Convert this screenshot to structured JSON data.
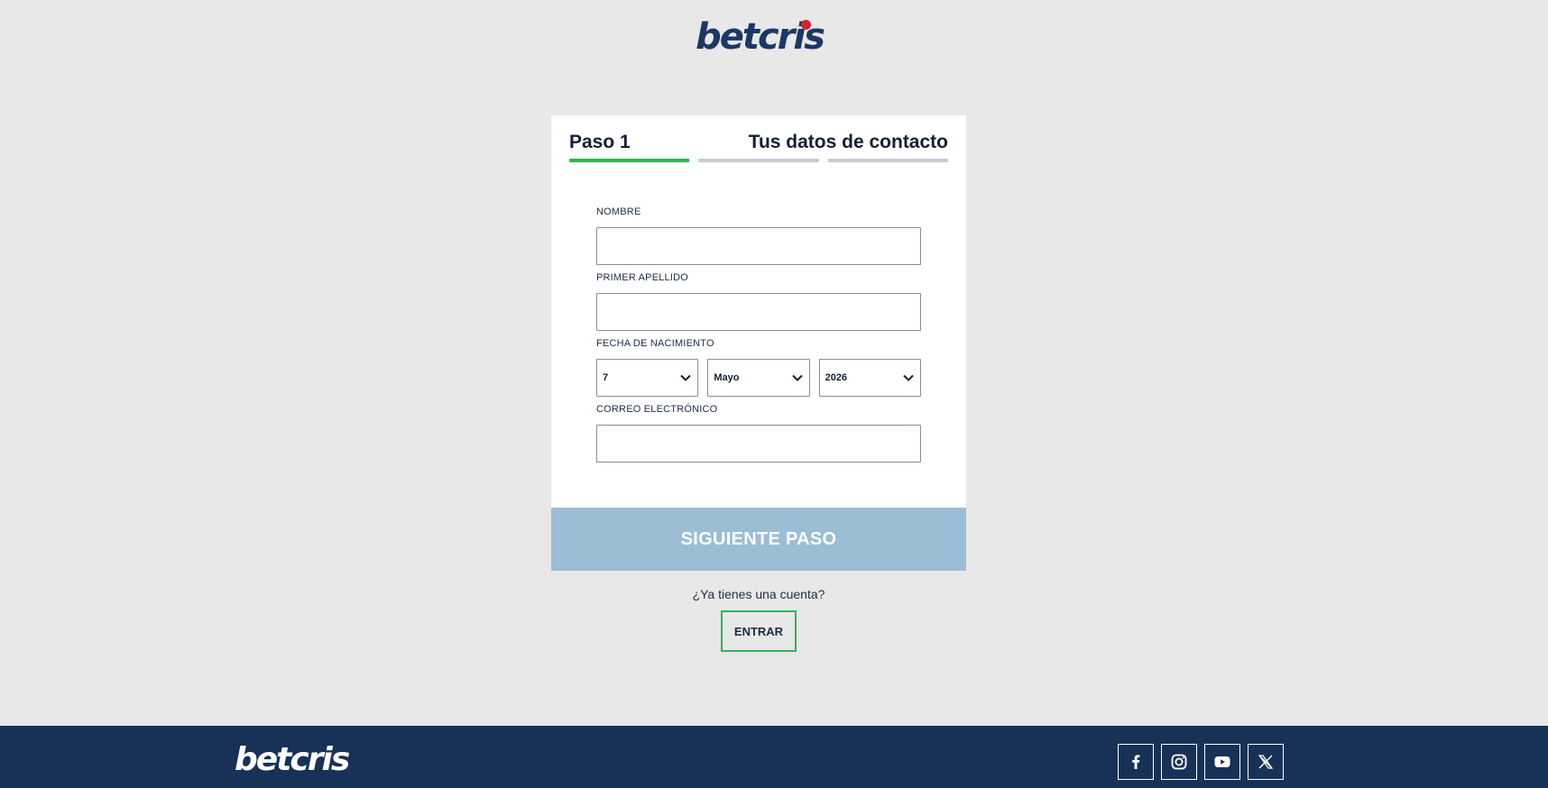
{
  "brand": {
    "name": "betcris"
  },
  "steps": {
    "step_label": "Paso 1",
    "title": "Tus datos de contacto",
    "total": 3,
    "current": 1
  },
  "form": {
    "first_name": {
      "label": "NOMBRE",
      "value": ""
    },
    "last_name": {
      "label": "PRIMER APELLIDO",
      "value": ""
    },
    "birth_date": {
      "label": "FECHA DE NACIMIENTO",
      "day": "7",
      "month": "Mayo",
      "year": "2026"
    },
    "email": {
      "label": "CORREO ELECTRÓNICO",
      "value": ""
    }
  },
  "actions": {
    "next_label": "SIGUIENTE PASO",
    "have_account": "¿Ya tienes una cuenta?",
    "login_label": "ENTRAR"
  },
  "footer": {
    "socials": [
      "facebook-icon",
      "instagram-icon",
      "youtube-icon",
      "x-icon"
    ]
  },
  "colors": {
    "brand_navy": "#173157",
    "accent_green": "#2cb557",
    "next_button_disabled": "#9bbdd6",
    "logo_dot_red": "#d6222f"
  }
}
